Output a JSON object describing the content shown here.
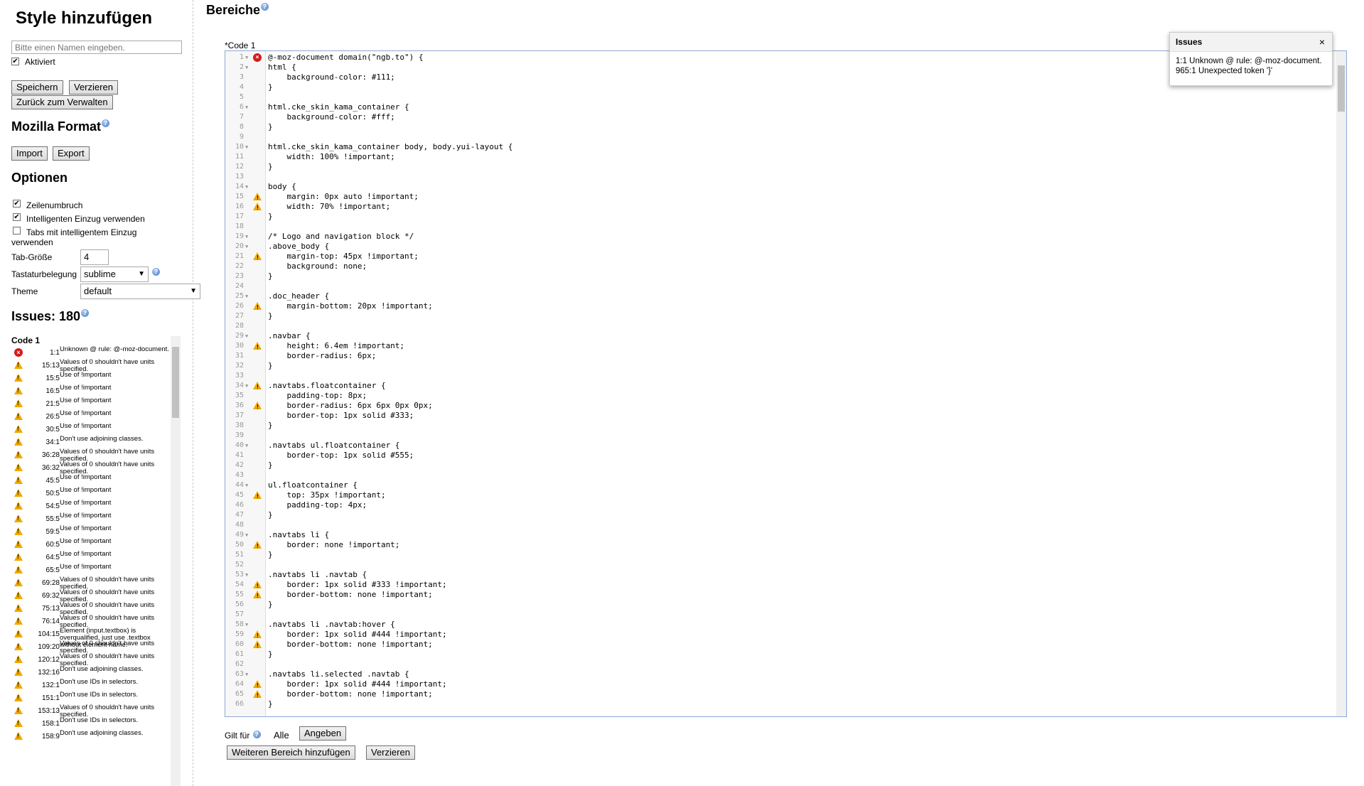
{
  "sidebar": {
    "title": "Style hinzufügen",
    "name_placeholder": "Bitte einen Namen eingeben.",
    "enabled_label": "Aktiviert",
    "save": "Speichern",
    "discard": "Verzieren",
    "back": "Zurück zum Verwalten",
    "mozilla_format": "Mozilla Format",
    "import": "Import",
    "export": "Export",
    "options_title": "Optionen",
    "options": {
      "wrap": "Zeilenumbruch",
      "smart_indent": "Intelligenten Einzug verwenden",
      "tabs_smart_1": "Tabs mit intelligentem Einzug",
      "tabs_smart_2": "verwenden",
      "tab_size_label": "Tab-Größe",
      "tab_size_value": "4",
      "keymap_label": "Tastaturbelegung",
      "keymap_value": "sublime",
      "theme_label": "Theme",
      "theme_value": "default"
    },
    "issues_title": "Issues: 180",
    "issues_code_title": "Code 1",
    "issues": [
      {
        "type": "error",
        "pos": "1:1",
        "msg": "Unknown @ rule: @-moz-document."
      },
      {
        "type": "warn",
        "pos": "15:13",
        "msg": "Values of 0 shouldn't have units specified."
      },
      {
        "type": "warn",
        "pos": "15:5",
        "msg": "Use of !important"
      },
      {
        "type": "warn",
        "pos": "16:5",
        "msg": "Use of !important"
      },
      {
        "type": "warn",
        "pos": "21:5",
        "msg": "Use of !important"
      },
      {
        "type": "warn",
        "pos": "26:5",
        "msg": "Use of !important"
      },
      {
        "type": "warn",
        "pos": "30:5",
        "msg": "Use of !important"
      },
      {
        "type": "warn",
        "pos": "34:1",
        "msg": "Don't use adjoining classes."
      },
      {
        "type": "warn",
        "pos": "36:28",
        "msg": "Values of 0 shouldn't have units specified."
      },
      {
        "type": "warn",
        "pos": "36:32",
        "msg": "Values of 0 shouldn't have units specified."
      },
      {
        "type": "warn",
        "pos": "45:5",
        "msg": "Use of !important"
      },
      {
        "type": "warn",
        "pos": "50:5",
        "msg": "Use of !important"
      },
      {
        "type": "warn",
        "pos": "54:5",
        "msg": "Use of !important"
      },
      {
        "type": "warn",
        "pos": "55:5",
        "msg": "Use of !important"
      },
      {
        "type": "warn",
        "pos": "59:5",
        "msg": "Use of !important"
      },
      {
        "type": "warn",
        "pos": "60:5",
        "msg": "Use of !important"
      },
      {
        "type": "warn",
        "pos": "64:5",
        "msg": "Use of !important"
      },
      {
        "type": "warn",
        "pos": "65:5",
        "msg": "Use of !important"
      },
      {
        "type": "warn",
        "pos": "69:28",
        "msg": "Values of 0 shouldn't have units specified."
      },
      {
        "type": "warn",
        "pos": "69:32",
        "msg": "Values of 0 shouldn't have units specified."
      },
      {
        "type": "warn",
        "pos": "75:13",
        "msg": "Values of 0 shouldn't have units specified."
      },
      {
        "type": "warn",
        "pos": "76:14",
        "msg": "Values of 0 shouldn't have units specified."
      },
      {
        "type": "warn",
        "pos": "104:15",
        "msg": "Element (input.textbox) is overqualified, just use .textbox without element name."
      },
      {
        "type": "warn",
        "pos": "109:20",
        "msg": "Values of 0 shouldn't have units specified."
      },
      {
        "type": "warn",
        "pos": "120:12",
        "msg": "Values of 0 shouldn't have units specified."
      },
      {
        "type": "warn",
        "pos": "132:16",
        "msg": "Don't use adjoining classes."
      },
      {
        "type": "warn",
        "pos": "132:1",
        "msg": "Don't use IDs in selectors."
      },
      {
        "type": "warn",
        "pos": "151:1",
        "msg": "Don't use IDs in selectors."
      },
      {
        "type": "warn",
        "pos": "153:13",
        "msg": "Values of 0 shouldn't have units specified."
      },
      {
        "type": "warn",
        "pos": "158:1",
        "msg": "Don't use IDs in selectors."
      },
      {
        "type": "warn",
        "pos": "158:9",
        "msg": "Don't use adjoining classes."
      }
    ]
  },
  "main": {
    "sections_title": "Bereiche",
    "code_label": "*Code 1",
    "applies_to": "Gilt für",
    "applies_value": "Alle",
    "specify": "Angeben",
    "add_section": "Weiteren Bereich hinzufügen",
    "remove": "Verzieren"
  },
  "popup": {
    "title": "Issues",
    "close": "×",
    "lines": [
      "1:1 Unknown @ rule: @-moz-document.",
      "965:1 Unexpected token '}'"
    ]
  },
  "code_lines": [
    {
      "n": "1",
      "t": "@-moz-document domain(\"ngb.to\") {",
      "m": "error",
      "f": true
    },
    {
      "n": "2",
      "t": "html {",
      "m": "",
      "f": true
    },
    {
      "n": "3",
      "t": "    background-color: #111;",
      "m": ""
    },
    {
      "n": "4",
      "t": "}",
      "m": ""
    },
    {
      "n": "5",
      "t": "",
      "m": ""
    },
    {
      "n": "6",
      "t": "html.cke_skin_kama_container {",
      "m": "",
      "f": true
    },
    {
      "n": "7",
      "t": "    background-color: #fff;",
      "m": ""
    },
    {
      "n": "8",
      "t": "}",
      "m": ""
    },
    {
      "n": "9",
      "t": "",
      "m": ""
    },
    {
      "n": "10",
      "t": "html.cke_skin_kama_container body, body.yui-layout {",
      "m": "",
      "f": true
    },
    {
      "n": "11",
      "t": "    width: 100% !important;",
      "m": ""
    },
    {
      "n": "12",
      "t": "}",
      "m": ""
    },
    {
      "n": "13",
      "t": "",
      "m": ""
    },
    {
      "n": "14",
      "t": "body {",
      "m": "",
      "f": true
    },
    {
      "n": "15",
      "t": "    margin: 0px auto !important;",
      "m": "warn"
    },
    {
      "n": "16",
      "t": "    width: 70% !important;",
      "m": "warn"
    },
    {
      "n": "17",
      "t": "}",
      "m": ""
    },
    {
      "n": "18",
      "t": "",
      "m": ""
    },
    {
      "n": "19",
      "t": "/* Logo and navigation block */",
      "m": "",
      "f": true
    },
    {
      "n": "20",
      "t": ".above_body {",
      "m": "",
      "f": true
    },
    {
      "n": "21",
      "t": "    margin-top: 45px !important;",
      "m": "warn"
    },
    {
      "n": "22",
      "t": "    background: none;",
      "m": ""
    },
    {
      "n": "23",
      "t": "}",
      "m": ""
    },
    {
      "n": "24",
      "t": "",
      "m": ""
    },
    {
      "n": "25",
      "t": ".doc_header {",
      "m": "",
      "f": true
    },
    {
      "n": "26",
      "t": "    margin-bottom: 20px !important;",
      "m": "warn"
    },
    {
      "n": "27",
      "t": "}",
      "m": ""
    },
    {
      "n": "28",
      "t": "",
      "m": ""
    },
    {
      "n": "29",
      "t": ".navbar {",
      "m": "",
      "f": true
    },
    {
      "n": "30",
      "t": "    height: 6.4em !important;",
      "m": "warn"
    },
    {
      "n": "31",
      "t": "    border-radius: 6px;",
      "m": ""
    },
    {
      "n": "32",
      "t": "}",
      "m": ""
    },
    {
      "n": "33",
      "t": "",
      "m": ""
    },
    {
      "n": "34",
      "t": ".navtabs.floatcontainer {",
      "m": "warn",
      "f": true
    },
    {
      "n": "35",
      "t": "    padding-top: 8px;",
      "m": ""
    },
    {
      "n": "36",
      "t": "    border-radius: 6px 6px 0px 0px;",
      "m": "warn"
    },
    {
      "n": "37",
      "t": "    border-top: 1px solid #333;",
      "m": ""
    },
    {
      "n": "38",
      "t": "}",
      "m": ""
    },
    {
      "n": "39",
      "t": "",
      "m": ""
    },
    {
      "n": "40",
      "t": ".navtabs ul.floatcontainer {",
      "m": "",
      "f": true
    },
    {
      "n": "41",
      "t": "    border-top: 1px solid #555;",
      "m": ""
    },
    {
      "n": "42",
      "t": "}",
      "m": ""
    },
    {
      "n": "43",
      "t": "",
      "m": ""
    },
    {
      "n": "44",
      "t": "ul.floatcontainer {",
      "m": "",
      "f": true
    },
    {
      "n": "45",
      "t": "    top: 35px !important;",
      "m": "warn"
    },
    {
      "n": "46",
      "t": "    padding-top: 4px;",
      "m": ""
    },
    {
      "n": "47",
      "t": "}",
      "m": ""
    },
    {
      "n": "48",
      "t": "",
      "m": ""
    },
    {
      "n": "49",
      "t": ".navtabs li {",
      "m": "",
      "f": true
    },
    {
      "n": "50",
      "t": "    border: none !important;",
      "m": "warn"
    },
    {
      "n": "51",
      "t": "}",
      "m": ""
    },
    {
      "n": "52",
      "t": "",
      "m": ""
    },
    {
      "n": "53",
      "t": ".navtabs li .navtab {",
      "m": "",
      "f": true
    },
    {
      "n": "54",
      "t": "    border: 1px solid #333 !important;",
      "m": "warn"
    },
    {
      "n": "55",
      "t": "    border-bottom: none !important;",
      "m": "warn"
    },
    {
      "n": "56",
      "t": "}",
      "m": ""
    },
    {
      "n": "57",
      "t": "",
      "m": ""
    },
    {
      "n": "58",
      "t": ".navtabs li .navtab:hover {",
      "m": "",
      "f": true
    },
    {
      "n": "59",
      "t": "    border: 1px solid #444 !important;",
      "m": "warn"
    },
    {
      "n": "60",
      "t": "    border-bottom: none !important;",
      "m": "warn"
    },
    {
      "n": "61",
      "t": "}",
      "m": ""
    },
    {
      "n": "62",
      "t": "",
      "m": ""
    },
    {
      "n": "63",
      "t": ".navtabs li.selected .navtab {",
      "m": "",
      "f": true
    },
    {
      "n": "64",
      "t": "    border: 1px solid #444 !important;",
      "m": "warn"
    },
    {
      "n": "65",
      "t": "    border-bottom: none !important;",
      "m": "warn"
    },
    {
      "n": "66",
      "t": "}",
      "m": ""
    }
  ]
}
